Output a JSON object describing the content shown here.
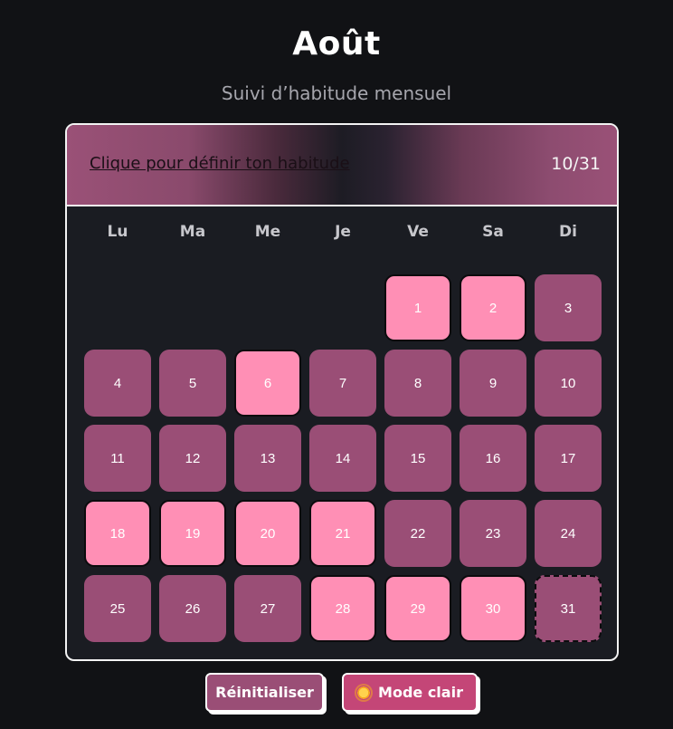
{
  "page": {
    "title": "Août",
    "subtitle": "Suivi d’habitude mensuel"
  },
  "header": {
    "habit_prompt": "Clique pour définir ton habitude",
    "count": "10/31"
  },
  "weekdays": [
    "Lu",
    "Ma",
    "Me",
    "Je",
    "Ve",
    "Sa",
    "Di"
  ],
  "calendar": {
    "first_weekday_index": 4,
    "today": 31,
    "days": [
      {
        "num": "1",
        "done": true
      },
      {
        "num": "2",
        "done": true
      },
      {
        "num": "3",
        "done": false
      },
      {
        "num": "4",
        "done": false
      },
      {
        "num": "5",
        "done": false
      },
      {
        "num": "6",
        "done": true
      },
      {
        "num": "7",
        "done": false
      },
      {
        "num": "8",
        "done": false
      },
      {
        "num": "9",
        "done": false
      },
      {
        "num": "10",
        "done": false
      },
      {
        "num": "11",
        "done": false
      },
      {
        "num": "12",
        "done": false
      },
      {
        "num": "13",
        "done": false
      },
      {
        "num": "14",
        "done": false
      },
      {
        "num": "15",
        "done": false
      },
      {
        "num": "16",
        "done": false
      },
      {
        "num": "17",
        "done": false
      },
      {
        "num": "18",
        "done": true
      },
      {
        "num": "19",
        "done": true
      },
      {
        "num": "20",
        "done": true
      },
      {
        "num": "21",
        "done": true
      },
      {
        "num": "22",
        "done": false
      },
      {
        "num": "23",
        "done": false
      },
      {
        "num": "24",
        "done": false
      },
      {
        "num": "25",
        "done": false
      },
      {
        "num": "26",
        "done": false
      },
      {
        "num": "27",
        "done": false
      },
      {
        "num": "28",
        "done": true
      },
      {
        "num": "29",
        "done": true
      },
      {
        "num": "30",
        "done": true
      },
      {
        "num": "31",
        "done": false
      }
    ]
  },
  "buttons": {
    "reset_label": "Réinitialiser",
    "mode_label": "Mode clair",
    "mode_icon": "sun-icon"
  },
  "colors": {
    "background": "#111215",
    "card": "#1a1c22",
    "day_default": "#9a4e76",
    "day_done": "#ff8fb5",
    "mode_button": "#c44677"
  }
}
